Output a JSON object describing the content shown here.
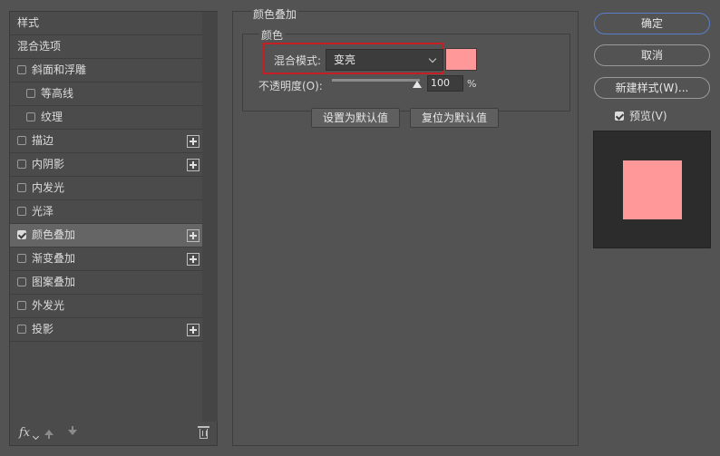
{
  "left_panel": {
    "items": [
      {
        "label": "样式",
        "checkbox": false,
        "checked": false,
        "plus": false,
        "indent": false,
        "selected": false
      },
      {
        "label": "混合选项",
        "checkbox": false,
        "checked": false,
        "plus": false,
        "indent": false,
        "selected": false
      },
      {
        "label": "斜面和浮雕",
        "checkbox": true,
        "checked": false,
        "plus": false,
        "indent": false,
        "selected": false
      },
      {
        "label": "等高线",
        "checkbox": true,
        "checked": false,
        "plus": false,
        "indent": true,
        "selected": false
      },
      {
        "label": "纹理",
        "checkbox": true,
        "checked": false,
        "plus": false,
        "indent": true,
        "selected": false
      },
      {
        "label": "描边",
        "checkbox": true,
        "checked": false,
        "plus": true,
        "indent": false,
        "selected": false
      },
      {
        "label": "内阴影",
        "checkbox": true,
        "checked": false,
        "plus": true,
        "indent": false,
        "selected": false
      },
      {
        "label": "内发光",
        "checkbox": true,
        "checked": false,
        "plus": false,
        "indent": false,
        "selected": false
      },
      {
        "label": "光泽",
        "checkbox": true,
        "checked": false,
        "plus": false,
        "indent": false,
        "selected": false
      },
      {
        "label": "颜色叠加",
        "checkbox": true,
        "checked": true,
        "plus": true,
        "indent": false,
        "selected": true
      },
      {
        "label": "渐变叠加",
        "checkbox": true,
        "checked": false,
        "plus": true,
        "indent": false,
        "selected": false
      },
      {
        "label": "图案叠加",
        "checkbox": true,
        "checked": false,
        "plus": false,
        "indent": false,
        "selected": false
      },
      {
        "label": "外发光",
        "checkbox": true,
        "checked": false,
        "plus": false,
        "indent": false,
        "selected": false
      },
      {
        "label": "投影",
        "checkbox": true,
        "checked": false,
        "plus": true,
        "indent": false,
        "selected": false
      }
    ],
    "bottom_icons": [
      "fx-icon",
      "arrow-up-icon",
      "arrow-down-icon",
      "trash-icon"
    ]
  },
  "section": {
    "title": "颜色叠加",
    "group_title": "颜色",
    "blend_mode_label": "混合模式:",
    "blend_mode_value": "变亮",
    "overlay_color": "#ff9999",
    "opacity_label": "不透明度(O):",
    "opacity_value": "100",
    "opacity_unit": "%",
    "set_default_label": "设置为默认值",
    "reset_default_label": "复位为默认值"
  },
  "right": {
    "ok_label": "确定",
    "cancel_label": "取消",
    "new_style_label": "新建样式(W)...",
    "preview_label": "预览(V)",
    "preview_checked": true,
    "preview_color": "#ff9999"
  }
}
